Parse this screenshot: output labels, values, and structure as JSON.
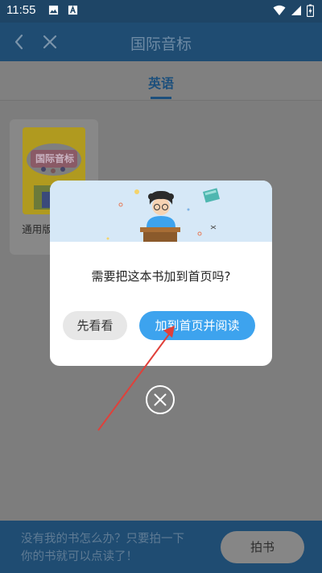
{
  "status_bar": {
    "time": "11:55",
    "icons": [
      "image-icon",
      "font-icon",
      "wifi-icon",
      "signal-icon",
      "battery-charging-icon"
    ]
  },
  "header": {
    "title": "国际音标",
    "back_icon": "back-icon",
    "close_icon": "close-icon"
  },
  "tabs": [
    {
      "label": "英语",
      "selected": true
    }
  ],
  "book": {
    "cover_title": "国际音标",
    "title": "通用版国际音标"
  },
  "dialog": {
    "message": "需要把这本书加到首页吗?",
    "later_button": "先看看",
    "confirm_button": "加到首页并阅读",
    "close_icon": "close-circle-icon"
  },
  "bottom_bar": {
    "message": "没有我的书怎么办？只要拍一下你的书就可以点读了！",
    "snap_button": "拍书"
  },
  "colors": {
    "header": "#1f4c72",
    "overlay": "#808080",
    "accent": "#3da3ee",
    "annotation_arrow": "#e0403a"
  }
}
